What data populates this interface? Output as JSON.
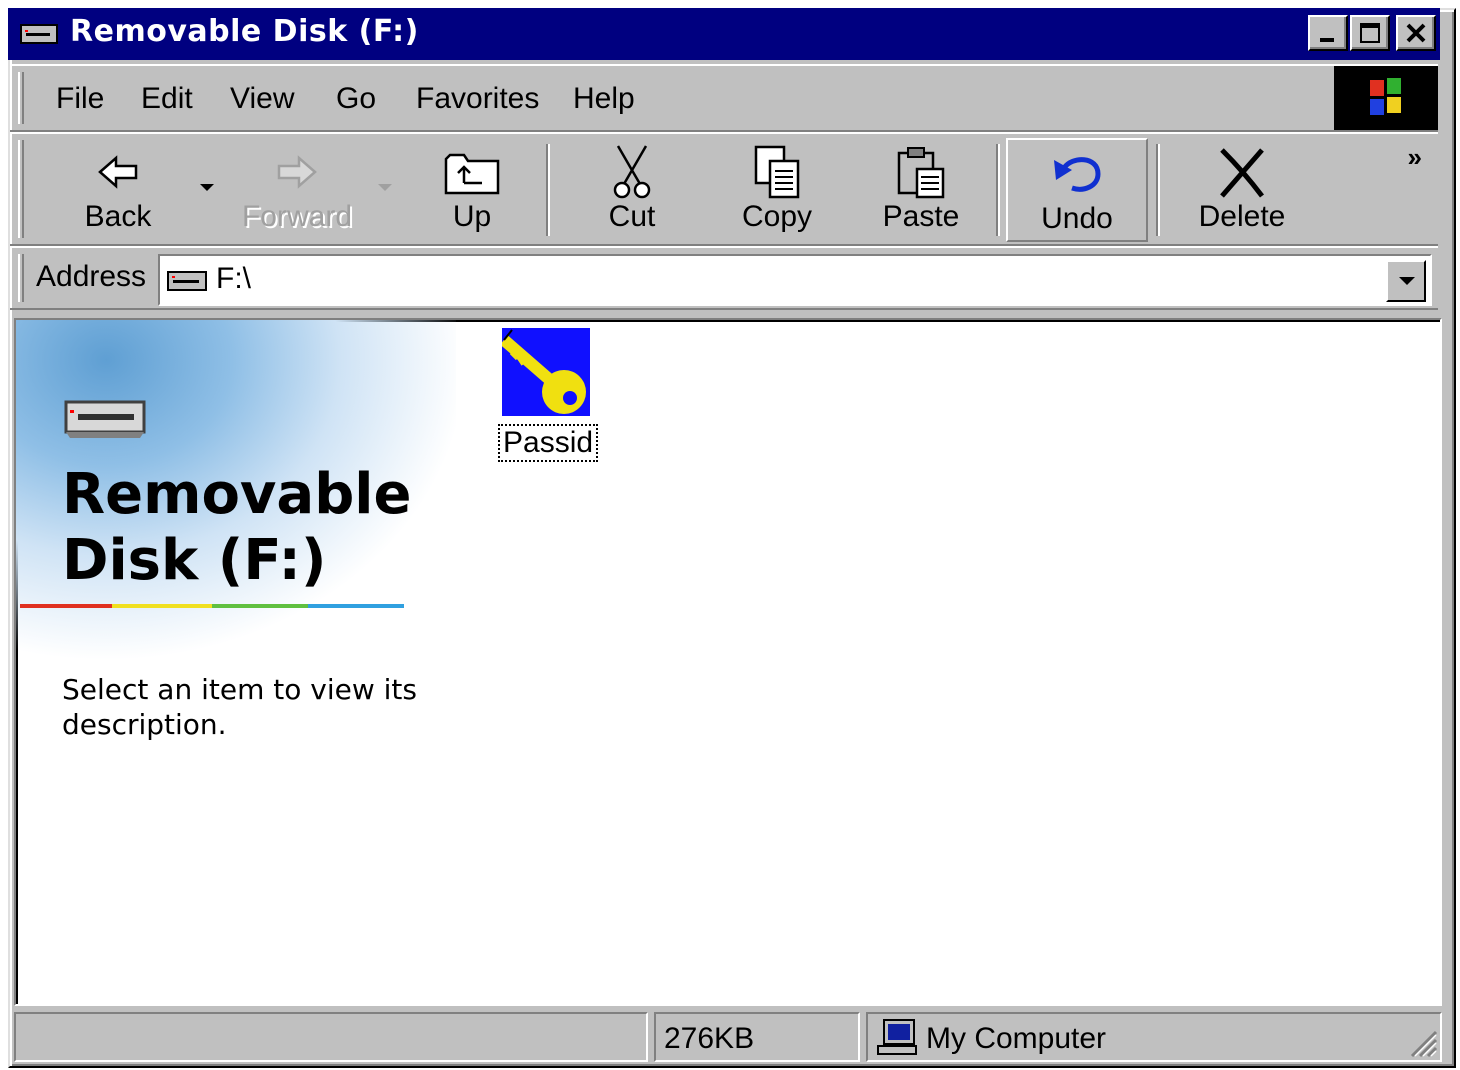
{
  "window": {
    "title": "Removable Disk (F:)"
  },
  "menu": [
    "File",
    "Edit",
    "View",
    "Go",
    "Favorites",
    "Help"
  ],
  "toolbar": {
    "back": "Back",
    "forward": "Forward",
    "up": "Up",
    "cut": "Cut",
    "copy": "Copy",
    "paste": "Paste",
    "undo": "Undo",
    "delete": "Delete",
    "more": "»"
  },
  "address": {
    "label": "Address",
    "value": "F:\\"
  },
  "panel": {
    "title": "Removable Disk (F:)",
    "description": "Select an item to view its description."
  },
  "files": [
    {
      "name": "Passid",
      "icon": "key-icon"
    }
  ],
  "status": {
    "left": "",
    "size": "276KB",
    "location": "My Computer"
  },
  "colors": {
    "titlebar": "#000080",
    "chrome": "#c0c0c0",
    "key_background": "#1010ff",
    "key": "#f0e010"
  }
}
